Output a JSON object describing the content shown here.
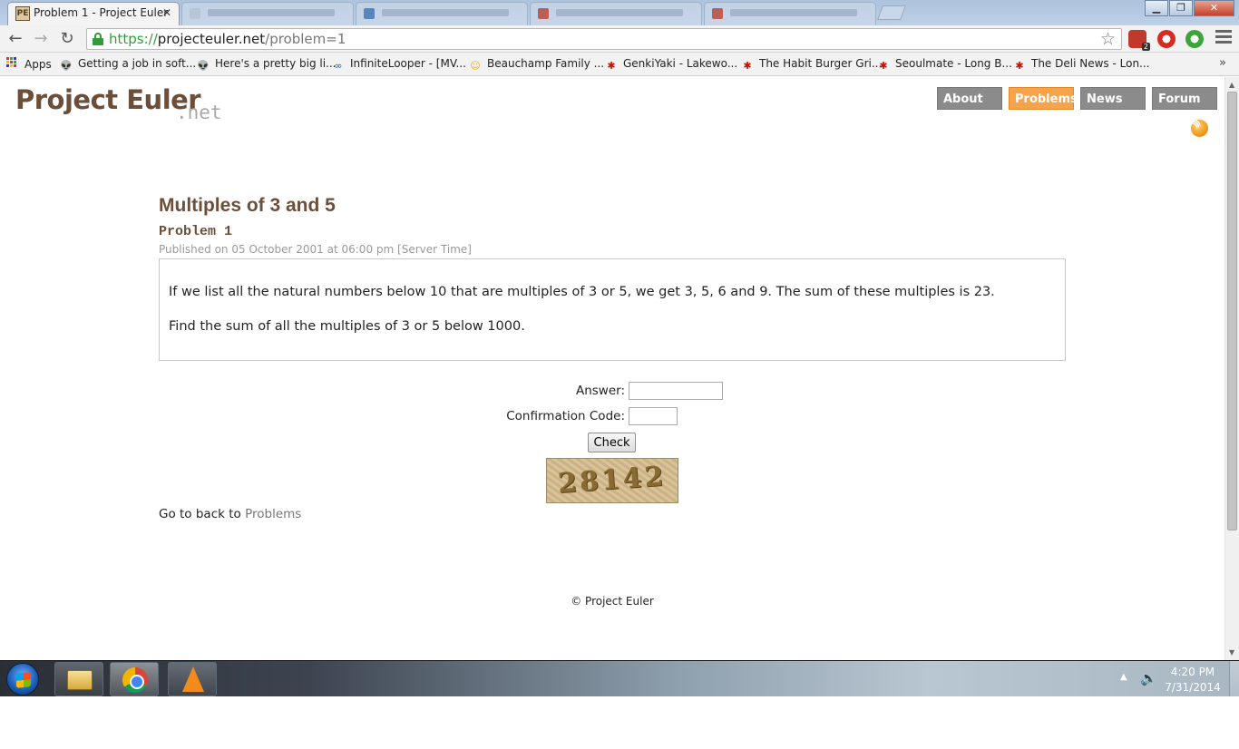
{
  "browser": {
    "active_tab": {
      "favicon": "PE",
      "title": "Problem 1 - Project Euler",
      "close": "✕"
    },
    "inactive_tabs": [
      {
        "icon_color": "#b8c4d2"
      },
      {
        "icon_color": "#3a6fb0"
      },
      {
        "icon_color": "#c0392b"
      },
      {
        "icon_color": "#c0392b"
      }
    ],
    "window_controls": {
      "minimize": "▁",
      "maximize": "❐",
      "close": "✕"
    },
    "nav": {
      "back": "←",
      "forward": "→",
      "reload": "↻"
    },
    "url": {
      "scheme": "https://",
      "host": "projecteuler.net",
      "path": "/problem=1"
    },
    "star": "☆",
    "extension_badge": "2",
    "bookmarks": [
      {
        "label": "Apps"
      },
      {
        "label": "Getting a job in soft...",
        "icon": "reddit-icon"
      },
      {
        "label": "Here's a pretty big li...",
        "icon": "reddit-icon"
      },
      {
        "label": "InfiniteLooper - [MV...",
        "icon": "infinity-icon"
      },
      {
        "label": "Beauchamp Family ...",
        "icon": "smiley-icon"
      },
      {
        "label": "GenkiYaki - Lakewo...",
        "icon": "yelp-icon"
      },
      {
        "label": "The Habit Burger Gri...",
        "icon": "yelp-icon"
      },
      {
        "label": "Seoulmate - Long B...",
        "icon": "yelp-icon"
      },
      {
        "label": "The Deli News - Lon...",
        "icon": "yelp-icon"
      }
    ],
    "bookmarks_overflow": "»"
  },
  "site": {
    "logo": {
      "main": "Project Euler",
      "suffix": ".net"
    },
    "nav": [
      {
        "label": "About",
        "active": false
      },
      {
        "label": "Problems",
        "active": true
      },
      {
        "label": "News",
        "active": false
      },
      {
        "label": "Forum",
        "active": false
      }
    ],
    "accent_color": "#f6a34b",
    "brand_color": "#6b4f3a"
  },
  "problem": {
    "title": "Multiples of 3 and 5",
    "number_label": "Problem 1",
    "published": "Published on 05 October 2001 at 06:00 pm [Server Time]",
    "paragraphs": [
      "If we list all the natural numbers below 10 that are multiples of 3 or 5, we get 3, 5, 6 and 9. The sum of these multiples is 23.",
      "Find the sum of all the multiples of 3 or 5 below 1000."
    ]
  },
  "form": {
    "answer_label": "Answer:",
    "answer_value": "",
    "confirmation_label": "Confirmation Code:",
    "confirmation_value": "",
    "check_label": "Check",
    "captcha_text": "28142"
  },
  "back": {
    "prefix": "Go to back to",
    "link": "Problems"
  },
  "footer": {
    "text": "© Project Euler"
  },
  "taskbar": {
    "time": "4:20 PM",
    "date": "7/31/2014",
    "tray_arrow": "▲",
    "speaker": "🔊"
  }
}
